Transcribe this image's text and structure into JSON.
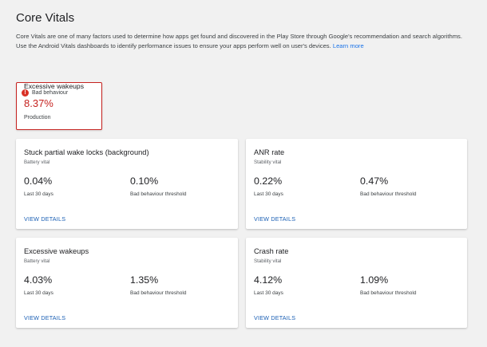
{
  "header": {
    "title": "Core Vitals",
    "intro_line1": "Core Vitals are one of many factors used to determine how apps get found and discovered in the Play Store through Google's recommendation and search algorithms.",
    "intro_line2": "Use the Android Vitals dashboards to identify performance issues to ensure your apps perform well on user's devices.",
    "learn_more": "Learn more"
  },
  "highlight": {
    "status": "Bad behaviour",
    "status_icon": "error-icon",
    "name": "Excessive wakeups",
    "value": "8.37%",
    "track": "Production",
    "accent_color": "#c5221f"
  },
  "cards": [
    {
      "title": "Stuck partial wake locks (background)",
      "subtitle": "Battery vital",
      "value": "0.04%",
      "value_label": "Last 30 days",
      "threshold": "0.10%",
      "threshold_label": "Bad behaviour threshold",
      "link": "VIEW DETAILS"
    },
    {
      "title": "ANR rate",
      "subtitle": "Stability vital",
      "value": "0.22%",
      "value_label": "Last 30 days",
      "threshold": "0.47%",
      "threshold_label": "Bad behaviour threshold",
      "link": "VIEW DETAILS"
    },
    {
      "title": "Excessive wakeups",
      "subtitle": "Battery vital",
      "value": "4.03%",
      "value_label": "Last 30 days",
      "threshold": "1.35%",
      "threshold_label": "Bad behaviour threshold",
      "link": "VIEW DETAILS"
    },
    {
      "title": "Crash rate",
      "subtitle": "Stability vital",
      "value": "4.12%",
      "value_label": "Last 30 days",
      "threshold": "1.09%",
      "threshold_label": "Bad behaviour threshold",
      "link": "VIEW DETAILS"
    }
  ]
}
